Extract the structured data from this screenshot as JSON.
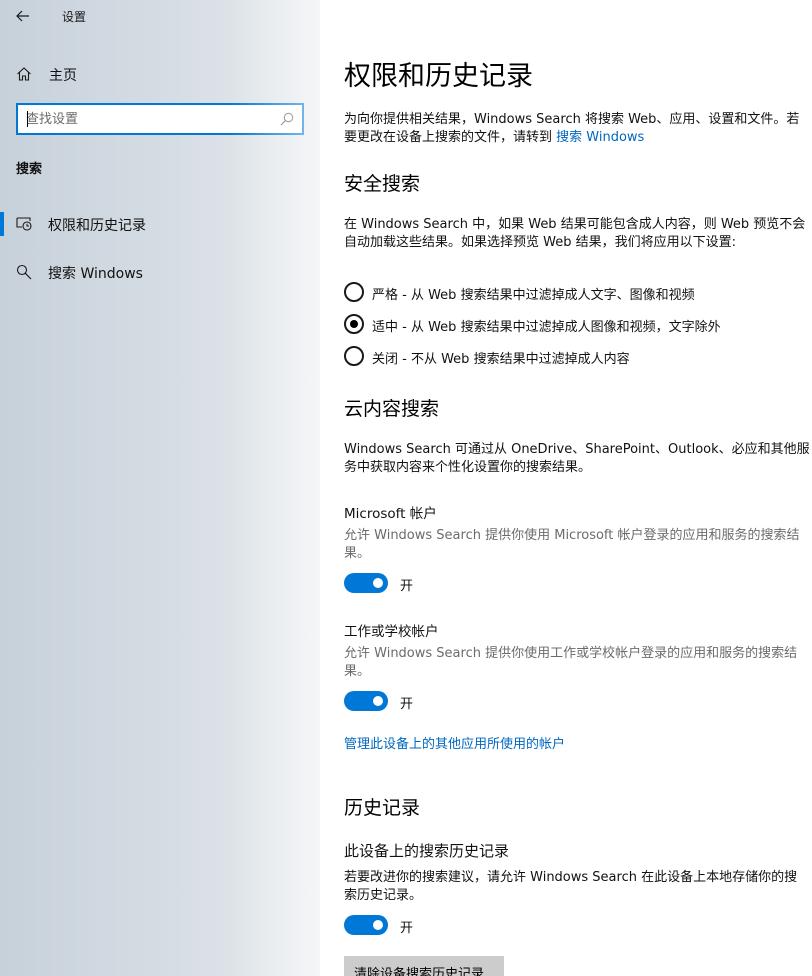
{
  "window": {
    "title": "设置"
  },
  "sidebar": {
    "home_label": "主页",
    "search_placeholder": "查找设置",
    "section_heading": "搜索",
    "items": [
      {
        "label": "权限和历史记录",
        "icon": "permissions-history-icon",
        "selected": true
      },
      {
        "label": "搜索 Windows",
        "icon": "search-icon",
        "selected": false
      }
    ]
  },
  "main": {
    "title": "权限和历史记录",
    "intro_text": "为向你提供相关结果，Windows Search 将搜索 Web、应用、设置和文件。若要更改在设备上搜索的文件，请转到 ",
    "intro_link": "搜索 Windows",
    "safe_search": {
      "title": "安全搜索",
      "description": "在 Windows Search 中，如果 Web 结果可能包含成人内容，则 Web 预览不会自动加载这些结果。如果选择预览 Web 结果，我们将应用以下设置:",
      "options": [
        {
          "label": "严格 - 从 Web 搜索结果中过滤掉成人文字、图像和视频",
          "selected": false
        },
        {
          "label": "适中 - 从 Web 搜索结果中过滤掉成人图像和视频，文字除外",
          "selected": true
        },
        {
          "label": "关闭 - 不从 Web 搜索结果中过滤掉成人内容",
          "selected": false
        }
      ]
    },
    "cloud_search": {
      "title": "云内容搜索",
      "description": "Windows Search 可通过从 OneDrive、SharePoint、Outlook、必应和其他服务中获取内容来个性化设置你的搜索结果。",
      "microsoft_account": {
        "label": "Microsoft 帐户",
        "description": "允许 Windows Search 提供你使用 Microsoft 帐户登录的应用和服务的搜索结果。",
        "toggle_state": "开",
        "on": true
      },
      "work_school_account": {
        "label": "工作或学校帐户",
        "description": "允许 Windows Search 提供你使用工作或学校帐户登录的应用和服务的搜索结果。",
        "toggle_state": "开",
        "on": true
      },
      "manage_link": "管理此设备上的其他应用所使用的帐户"
    },
    "history": {
      "title": "历史记录",
      "device_history_label": "此设备上的搜索历史记录",
      "description": "若要改进你的搜索建议，请允许 Windows Search 在此设备上本地存储你的搜索历史记录。",
      "toggle_state": "开",
      "on": true,
      "clear_button": "清除设备搜索历史记录"
    }
  },
  "colors": {
    "accent": "#0078d7",
    "link": "#0067c0",
    "secondary_text": "#6b6b6b",
    "button_gray": "#cccccc"
  }
}
